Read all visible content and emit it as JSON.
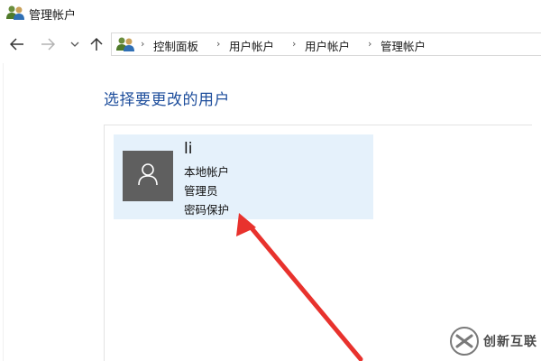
{
  "window": {
    "title": "管理帐户",
    "icon": "users-icon"
  },
  "nav": {
    "back_icon": "arrow-left-icon",
    "forward_icon": "arrow-right-icon",
    "recent_icon": "chevron-down-icon",
    "up_icon": "arrow-up-icon"
  },
  "breadcrumb": {
    "icon": "users-icon",
    "items": [
      "控制面板",
      "用户帐户",
      "用户帐户",
      "管理帐户"
    ]
  },
  "main": {
    "heading": "选择要更改的用户"
  },
  "user": {
    "name": "li",
    "account_type": "本地帐户",
    "role": "管理员",
    "password_status": "密码保护",
    "avatar_icon": "user-silhouette-icon"
  },
  "annotation": {
    "arrow_color": "#e8322d"
  },
  "watermark": {
    "text": "创新互联"
  },
  "colors": {
    "heading": "#1e4e9c",
    "card_bg": "#e5f1fb",
    "avatar_bg": "#5f5f5f"
  }
}
